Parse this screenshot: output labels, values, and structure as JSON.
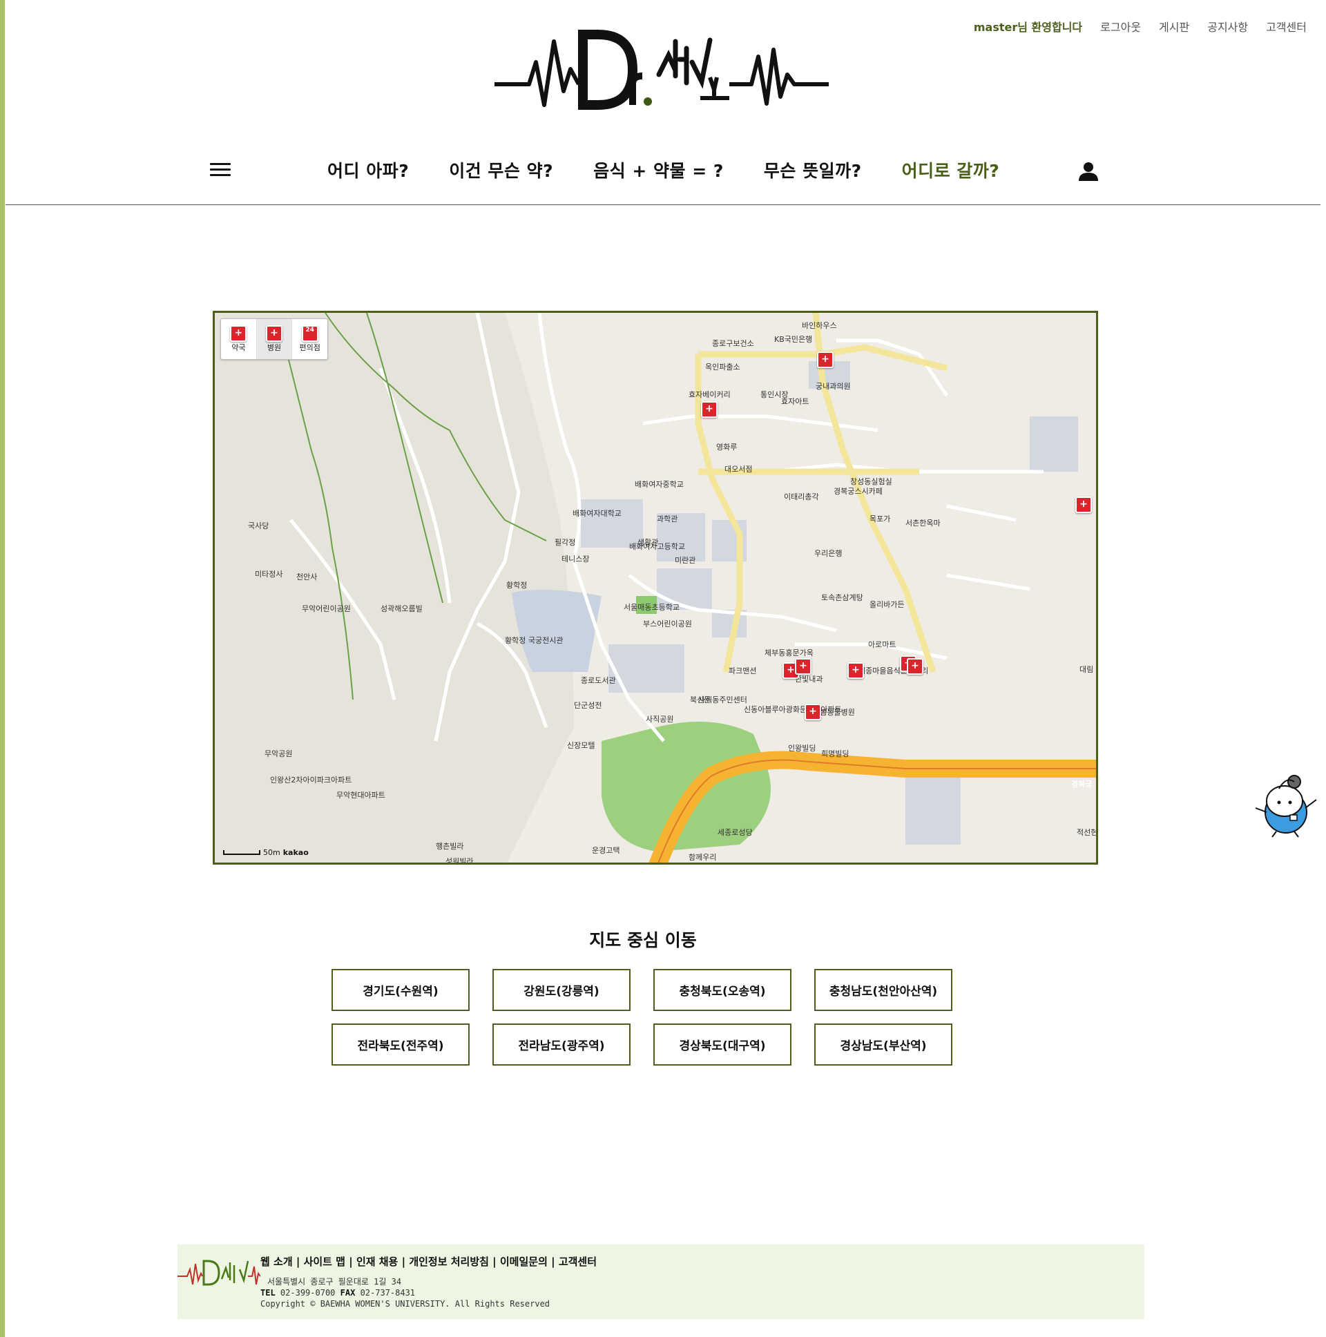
{
  "header": {
    "welcome": "master님 환영합니다",
    "links": [
      "로그아웃",
      "게시판",
      "공지사항",
      "고객센터"
    ]
  },
  "nav": {
    "items": [
      "어디 아파?",
      "이건 무슨 약?",
      "음식 + 약물 = ?",
      "무슨 뜻일까?",
      "어디로 갈까?"
    ],
    "active_index": 4
  },
  "map": {
    "controls": [
      "약국",
      "병원",
      "편의점"
    ],
    "selected_control": "병원",
    "scale_label": "50m",
    "provider": "kakao",
    "labels": [
      "국사당",
      "미타정사",
      "천안사",
      "무악어린이공원",
      "성곽해오름빌",
      "황학정",
      "황학정 국궁전시관",
      "종로도서관",
      "사직공원",
      "북신문",
      "단군성전",
      "신장모텔",
      "배화여자대학교",
      "배화여자중학교",
      "배화여자고등학교",
      "서울매동초등학교",
      "테니스장",
      "필각정",
      "과학관",
      "생활관",
      "미란관",
      "통인시장",
      "효자베이커리",
      "영화루",
      "대오서점",
      "이태리총각",
      "경복궁스시카페",
      "목포가",
      "서촌한옥마",
      "세종마을음식문화거리",
      "한빛내과",
      "누리봄동물병원",
      "사직동주민센터",
      "신동아블루아광화문의꿈아파트",
      "인왕빌딩",
      "희명빌딩",
      "체부동홍문가옥",
      "부스어린이공원",
      "창성동실험실",
      "효자아트",
      "궁내과의원",
      "종로구보건소",
      "KB국민은행",
      "바인하우스",
      "옥인파출소",
      "우리은행",
      "토속촌삼계탕",
      "올리바가든",
      "아로마트",
      "파크맨션",
      "무악현대아파트",
      "인왕산2차아이파크아파트",
      "무악공원",
      "행촌빌라",
      "성원빌라",
      "운경고택",
      "함께우리",
      "세종로성당",
      "적선현",
      "대림"
    ],
    "road_label": "경복궁"
  },
  "region_section": {
    "title": "지도 중심 이동",
    "buttons": [
      "경기도(수원역)",
      "강원도(강릉역)",
      "충청북도(오송역)",
      "충청남도(천안아산역)",
      "전라북도(전주역)",
      "전라남도(광주역)",
      "경상북도(대구역)",
      "경상남도(부산역)"
    ]
  },
  "footer": {
    "links": [
      "웹 소개",
      "사이트 맵",
      "인재 채용",
      "개인정보 처리방침",
      "이메일문의",
      "고객센터"
    ],
    "address": "서울특별시 종로구 필운대로 1길 34",
    "tel_label": "TEL",
    "tel": "02-399-0700",
    "fax_label": "FAX",
    "fax": "02-737-8431",
    "copyright": "Copyright © BAEWHA WOMEN'S UNIVERSITY. All Rights Reserved"
  },
  "colors": {
    "accent": "#4a5f16",
    "left_bar": "#a9c468",
    "footer_bg": "#eef5e2",
    "pin": "#d9262c"
  }
}
